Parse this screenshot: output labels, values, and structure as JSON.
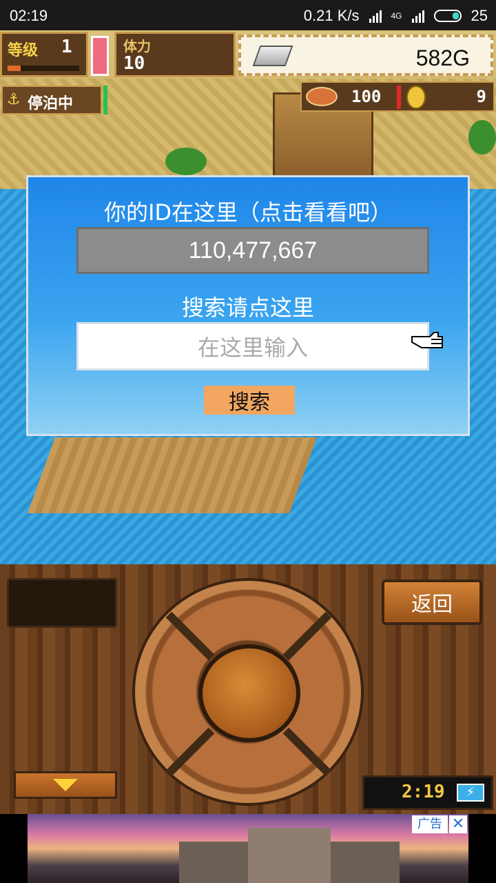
{
  "status_bar": {
    "time": "02:19",
    "speed": "0.21 K/s",
    "network": "4G",
    "battery": "25"
  },
  "hud": {
    "level_label": "等级",
    "level_value": "1",
    "stamina_label": "体力",
    "stamina_value": "10",
    "money": "582G",
    "status_label": "停泊中",
    "fish_count": "100",
    "coin_count": "9"
  },
  "dialog": {
    "title": "你的ID在这里（点击看看吧）",
    "id_value": "110,477,667",
    "subtitle": "搜索请点这里",
    "search_placeholder": "在这里输入",
    "search_button": "搜索"
  },
  "controller": {
    "back_button": "返回",
    "clock": "2:19"
  },
  "ad": {
    "label": "广告",
    "close": "✕"
  },
  "colors": {
    "dialog_blue": "#1f86ea",
    "search_button": "#f2a660",
    "wood": "#6a3f1e"
  },
  "icons": {
    "anchor": "anchor-icon",
    "pointer": "pointing-hand-icon",
    "battery": "battery-charging-icon"
  }
}
